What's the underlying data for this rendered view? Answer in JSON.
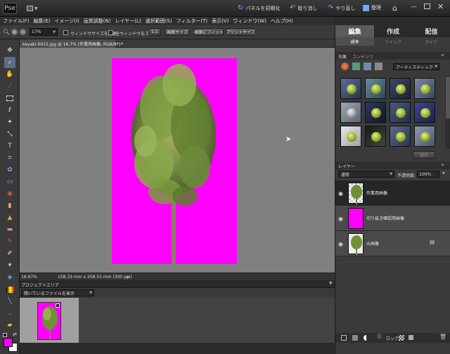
{
  "titlebar": {
    "reset_panels": "パネルを初期化",
    "undo": "取り消し",
    "redo": "やり直し",
    "organize": "整理"
  },
  "menu": [
    "ファイル(F)",
    "編集(E)",
    "イメージ(I)",
    "画質調整(N)",
    "レイヤー(L)",
    "選択範囲(S)",
    "フィルター(T)",
    "表示(V)",
    "ウィンドウ(W)",
    "ヘルプ(H)"
  ],
  "options": {
    "zoom": "17%",
    "resize_windows": "ウィンドウサイズを変更",
    "zoom_all_windows": "全ウィンドウをズーム",
    "one_to_one": "1:1",
    "actual_size": "画面サイズ",
    "fit_screen": "画面にフィット",
    "print_size": "プリントサイズ"
  },
  "doc_tab": "keyaki-0015.jpg @ 16.7% (作業用画像, RGB/8*)",
  "status": {
    "zoom": "16.67%",
    "dimensions": "158.33 mm x 258.53 mm (300 ppi)"
  },
  "project_bin": {
    "title": "プロジェクトエリア",
    "dropdown": "開いているファイルを表示"
  },
  "right_tabs": {
    "main": [
      "編集",
      "作成",
      "配信"
    ],
    "sub": [
      "標準",
      "クイック",
      "ガイド"
    ]
  },
  "effects": {
    "tabs": [
      "効果",
      "コンテンツ"
    ],
    "dropdown": "アーティスティック",
    "apply": "適用"
  },
  "layers": {
    "title": "レイヤー",
    "blend_mode": "通常",
    "opacity_label": "不透明度:",
    "opacity_value": "100%",
    "items": [
      "作業用画像",
      "切り抜き確認用画像",
      "元画像"
    ],
    "lock_label": "ロック"
  },
  "colors": {
    "foreground": "#ff00ff",
    "background": "#ffffff"
  }
}
